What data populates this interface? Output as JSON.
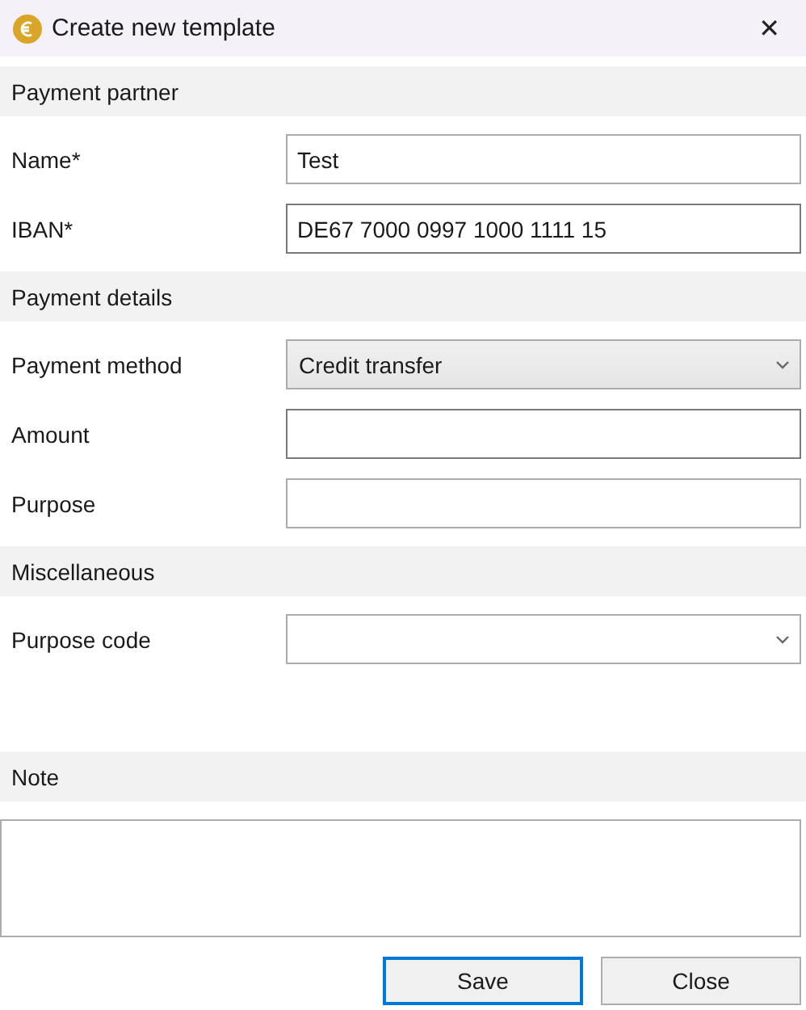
{
  "window": {
    "title": "Create new template",
    "close": "✕"
  },
  "sections": [
    {
      "title": "Payment partner",
      "fields": [
        {
          "label": "Name*",
          "kind": "text",
          "value": "Test",
          "focused": false
        },
        {
          "label": "IBAN*",
          "kind": "text",
          "value": "DE67 7000 0997 1000 1111 15",
          "focused": true
        }
      ]
    },
    {
      "title": "Payment details",
      "fields": [
        {
          "label": "Payment method",
          "kind": "select",
          "value": "Credit transfer"
        },
        {
          "label": "Amount",
          "kind": "text",
          "focused": true
        },
        {
          "label": "Purpose",
          "kind": "text",
          "focused": false
        }
      ]
    },
    {
      "title": "Miscellaneous",
      "fields": [
        {
          "label": "Purpose code",
          "kind": "select"
        }
      ]
    }
  ],
  "note": {
    "title": "Note"
  },
  "buttons": [
    {
      "label": "Save",
      "default": true
    },
    {
      "label": "Close",
      "default": false
    }
  ]
}
